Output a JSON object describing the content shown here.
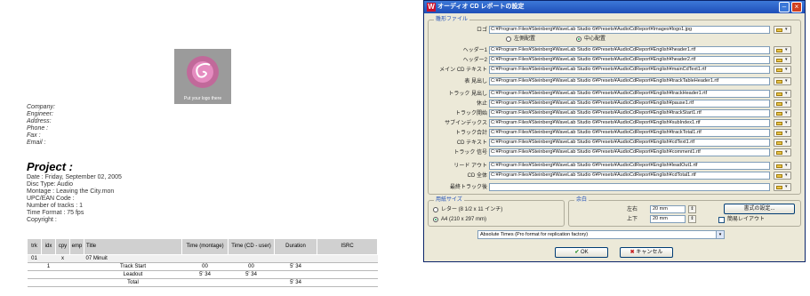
{
  "preview": {
    "logo_caption": "Put your logo there",
    "info_lines": [
      "Company:",
      "Engineer:",
      "Address:",
      "Phone :",
      "Fax :",
      "Email :"
    ],
    "project_title": "Project :",
    "project_lines": [
      "Date : Friday, September 02, 2005",
      "Disc Type: Audio",
      "Montage : Leaving the City.mon",
      "UPC/EAN Code :",
      "Number of tracks : 1",
      "Time Format : 75 fps",
      "Copyright :"
    ],
    "table": {
      "headers": [
        "trk",
        "idx",
        "cpy",
        "emp",
        "Title",
        "Time (montage)",
        "Time (CD - user)",
        "Duration",
        "ISRC"
      ],
      "rows": [
        [
          "01",
          "",
          "x",
          "",
          "07 Minuit",
          "",
          "",
          "",
          ""
        ],
        [
          "",
          "1",
          "",
          "",
          "Track Start",
          "00",
          "00",
          "5' 34",
          ""
        ],
        [
          "",
          "",
          "",
          "",
          "Leadout",
          "5' 34",
          "5' 34",
          "",
          ""
        ],
        [
          "",
          "",
          "",
          "",
          "Total",
          "",
          "",
          "5' 34",
          ""
        ]
      ]
    }
  },
  "dialog": {
    "title": "オーディオ CD レポートの設定",
    "files_group_label": "雛形ファイル",
    "logo_label": "ロゴ",
    "logo_path": "C:¥Program Files¥Steinberg¥WaveLab Studio 6¥Presets¥AudioCdReport¥Images¥logo1.jpg",
    "align_options": [
      "左側配置",
      "中心配置"
    ],
    "align_selected": 1,
    "fields": [
      {
        "label": "ヘッダー1",
        "path": "C:¥Program Files¥Steinberg¥WaveLab Studio 6¥Presets¥AudioCdReport¥English¥header1.rtf"
      },
      {
        "label": "ヘッダー2",
        "path": "C:¥Program Files¥Steinberg¥WaveLab Studio 6¥Presets¥AudioCdReport¥English¥header2.rtf"
      },
      {
        "label": "メイン CD テキスト",
        "path": "C:¥Program Files¥Steinberg¥WaveLab Studio 6¥Presets¥AudioCdReport¥English¥mainCdText1.rtf"
      },
      {
        "label": "表 見出し",
        "path": "C:¥Program Files¥Steinberg¥WaveLab Studio 6¥Presets¥AudioCdReport¥English¥trackTableHeader1.rtf"
      },
      {
        "label": "トラック 見出し",
        "path": "C:¥Program Files¥Steinberg¥WaveLab Studio 6¥Presets¥AudioCdReport¥English¥trackHeader1.rtf"
      },
      {
        "label": "休止",
        "path": "C:¥Program Files¥Steinberg¥WaveLab Studio 6¥Presets¥AudioCdReport¥English¥pause1.rtf"
      },
      {
        "label": "トラック開始",
        "path": "C:¥Program Files¥Steinberg¥WaveLab Studio 6¥Presets¥AudioCdReport¥English¥trackStart1.rtf"
      },
      {
        "label": "サブインデックス",
        "path": "C:¥Program Files¥Steinberg¥WaveLab Studio 6¥Presets¥AudioCdReport¥English¥subIndex1.rtf"
      },
      {
        "label": "トラック合計",
        "path": "C:¥Program Files¥Steinberg¥WaveLab Studio 6¥Presets¥AudioCdReport¥English¥trackTotal1.rtf"
      },
      {
        "label": "CD テキスト",
        "path": "C:¥Program Files¥Steinberg¥WaveLab Studio 6¥Presets¥AudioCdReport¥English¥cdText1.rtf"
      },
      {
        "label": "トラック 信号",
        "path": "C:¥Program Files¥Steinberg¥WaveLab Studio 6¥Presets¥AudioCdReport¥English¥comment1.rtf"
      },
      {
        "label": "リード アウト",
        "path": "C:¥Program Files¥Steinberg¥WaveLab Studio 6¥Presets¥AudioCdReport¥English¥leadOut1.rtf"
      },
      {
        "label": "CD 全体",
        "path": "C:¥Program Files¥Steinberg¥WaveLab Studio 6¥Presets¥AudioCdReport¥English¥cdTotal1.rtf"
      },
      {
        "label": "最終トラック後",
        "path": ""
      }
    ],
    "paper_group_label": "用紙サイズ",
    "paper_options": [
      "レター (8 1/2 x 11 インチ)",
      "A4 (210 x 297 mm)"
    ],
    "paper_selected": 1,
    "margin_group_label": "余白",
    "margin_left_label": "左右",
    "margin_left_value": "20 mm",
    "margin_top_label": "上下",
    "margin_top_value": "20 mm",
    "format_button": "書式の設定...",
    "compact_layout_label": "簡易レイアウト",
    "time_format": "Absolute Times (Pro format for replication factory)",
    "ok_label": "OK",
    "cancel_label": "キャンセル",
    "colors": {
      "titlebar": "#2a5fc8",
      "dialog_bg": "#ece9d8",
      "accent_label": "#1f4fb8"
    }
  }
}
